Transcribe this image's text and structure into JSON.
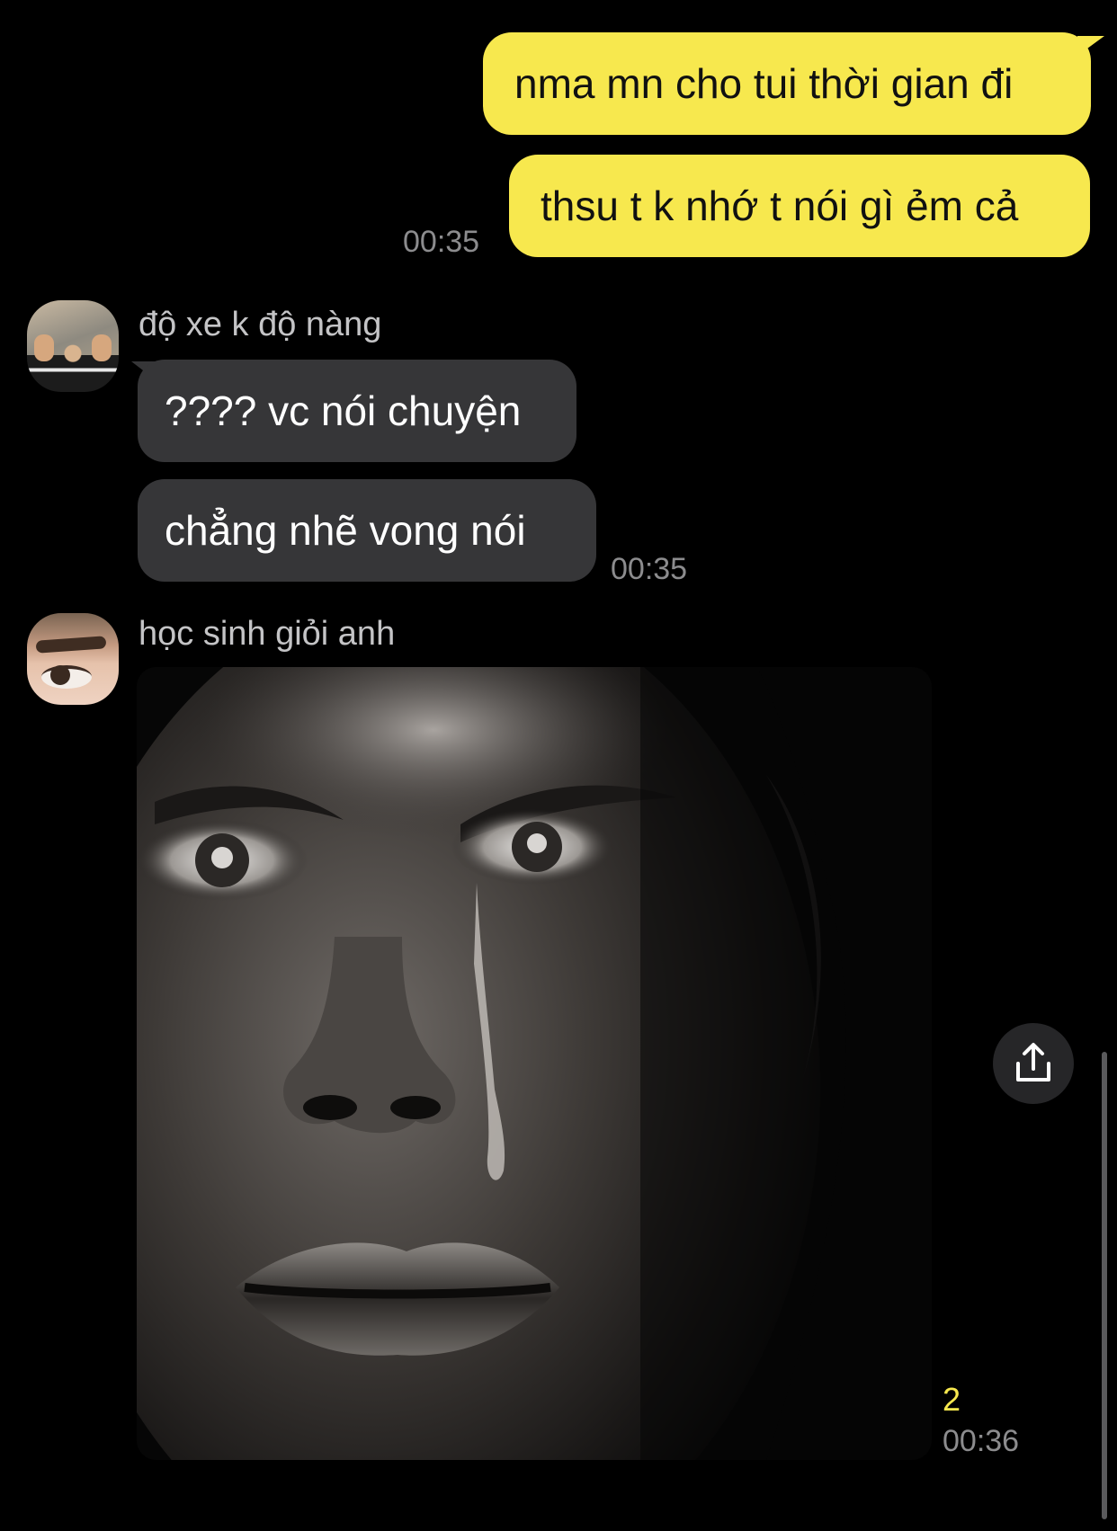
{
  "colors": {
    "outgoing_bubble": "#f7e84e",
    "incoming_bubble": "#363638",
    "background": "#000000",
    "timestamp": "#8c8c8e",
    "read_count": "#f7e84e"
  },
  "messages": {
    "outgoing": {
      "bubble_1": "nma mn cho tui thời gian đi",
      "bubble_2": "thsu t k nhớ t nói gì ẻm cả",
      "time": "00:35"
    },
    "group_1": {
      "sender": "độ xe k độ nàng",
      "bubble_1": "???? vc nói chuyện",
      "bubble_2": "chẳng nhẽ vong nói",
      "time": "00:35"
    },
    "group_2": {
      "sender": "học sinh giỏi anh",
      "photo_icon": "photo-message",
      "read_count": "2",
      "time": "00:36"
    }
  },
  "icons": {
    "share": "share-icon"
  }
}
